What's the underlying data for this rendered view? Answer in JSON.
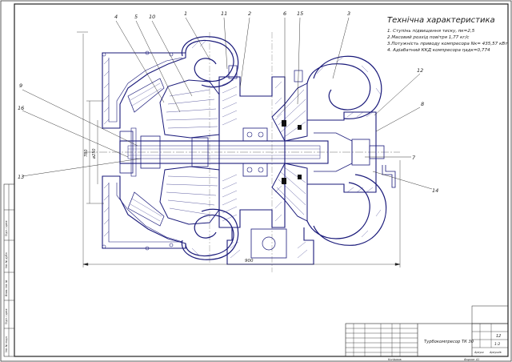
{
  "spec": {
    "title": "Технічна характеристика",
    "lines": [
      "1. Ступінь підвищення тиску, πк=2,5",
      "2.Масовий розхід повітря 1,77 кг/с",
      "3.Потужність приводу компресора Nк= 435,57 кВт",
      "4. Адіабатний ККД компресора ηадк=0,774"
    ]
  },
  "callouts": [
    "4",
    "5",
    "10",
    "1",
    "11",
    "2",
    "6",
    "15",
    "3",
    "12",
    "8",
    "9",
    "16",
    "13",
    "7",
    "14"
  ],
  "dimensions": {
    "overall_length": "900",
    "height_total": "780",
    "bore": "ø250"
  },
  "title_block": {
    "designation": "Турбокомпресор ТК 30",
    "sheet_label": "Аркуш",
    "sheets_label": "Аркушів",
    "scale_value": "1:2",
    "mass_value": "12"
  },
  "side_strip": {
    "labels": [
      "Інв. № подл.",
      "Підп. і дата",
      "Взам. інв. №",
      "Інв. № дубл.",
      "Підп. і дата"
    ]
  },
  "footer": {
    "left": "Копіював",
    "right": "Формат А1"
  }
}
